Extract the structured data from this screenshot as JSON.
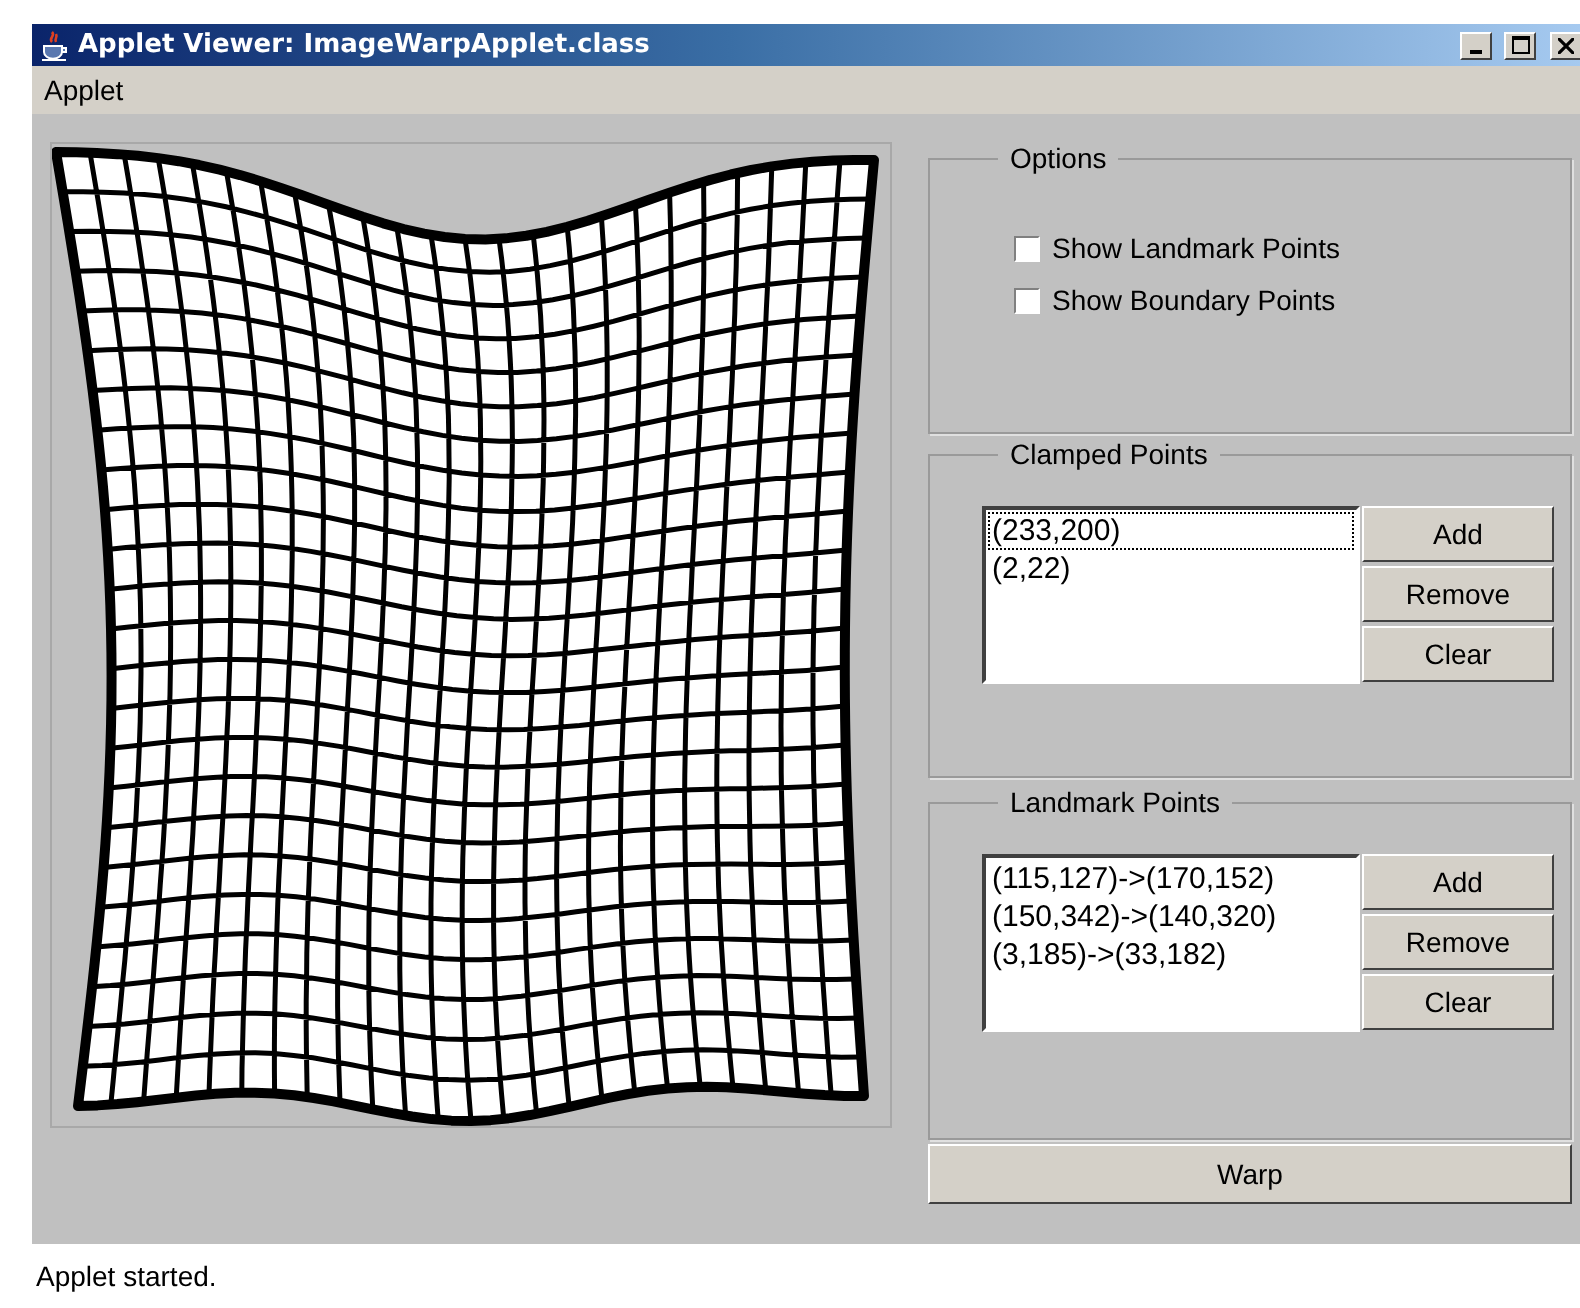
{
  "window": {
    "title": "Applet Viewer: ImageWarpApplet.class"
  },
  "menu": [
    "Applet"
  ],
  "options": {
    "title": "Options",
    "checkboxes": [
      {
        "label": "Show Landmark Points",
        "checked": false
      },
      {
        "label": "Show Boundary Points",
        "checked": false
      }
    ]
  },
  "clamped_points": {
    "title": "Clamped Points",
    "items": [
      {
        "text": "(233,200)",
        "focused": true
      },
      {
        "text": "(2,22)",
        "focused": false
      }
    ],
    "buttons": [
      "Add",
      "Remove",
      "Clear"
    ]
  },
  "landmark_points": {
    "title": "Landmark Points",
    "items": [
      {
        "text": "(115,127)->(170,152)",
        "focused": false
      },
      {
        "text": "(150,342)->(140,320)",
        "focused": false
      },
      {
        "text": "(3,185)->(33,182)",
        "focused": false
      }
    ],
    "buttons": [
      "Add",
      "Remove",
      "Clear"
    ]
  },
  "warp_button": "Warp",
  "status_bar": "Applet started."
}
